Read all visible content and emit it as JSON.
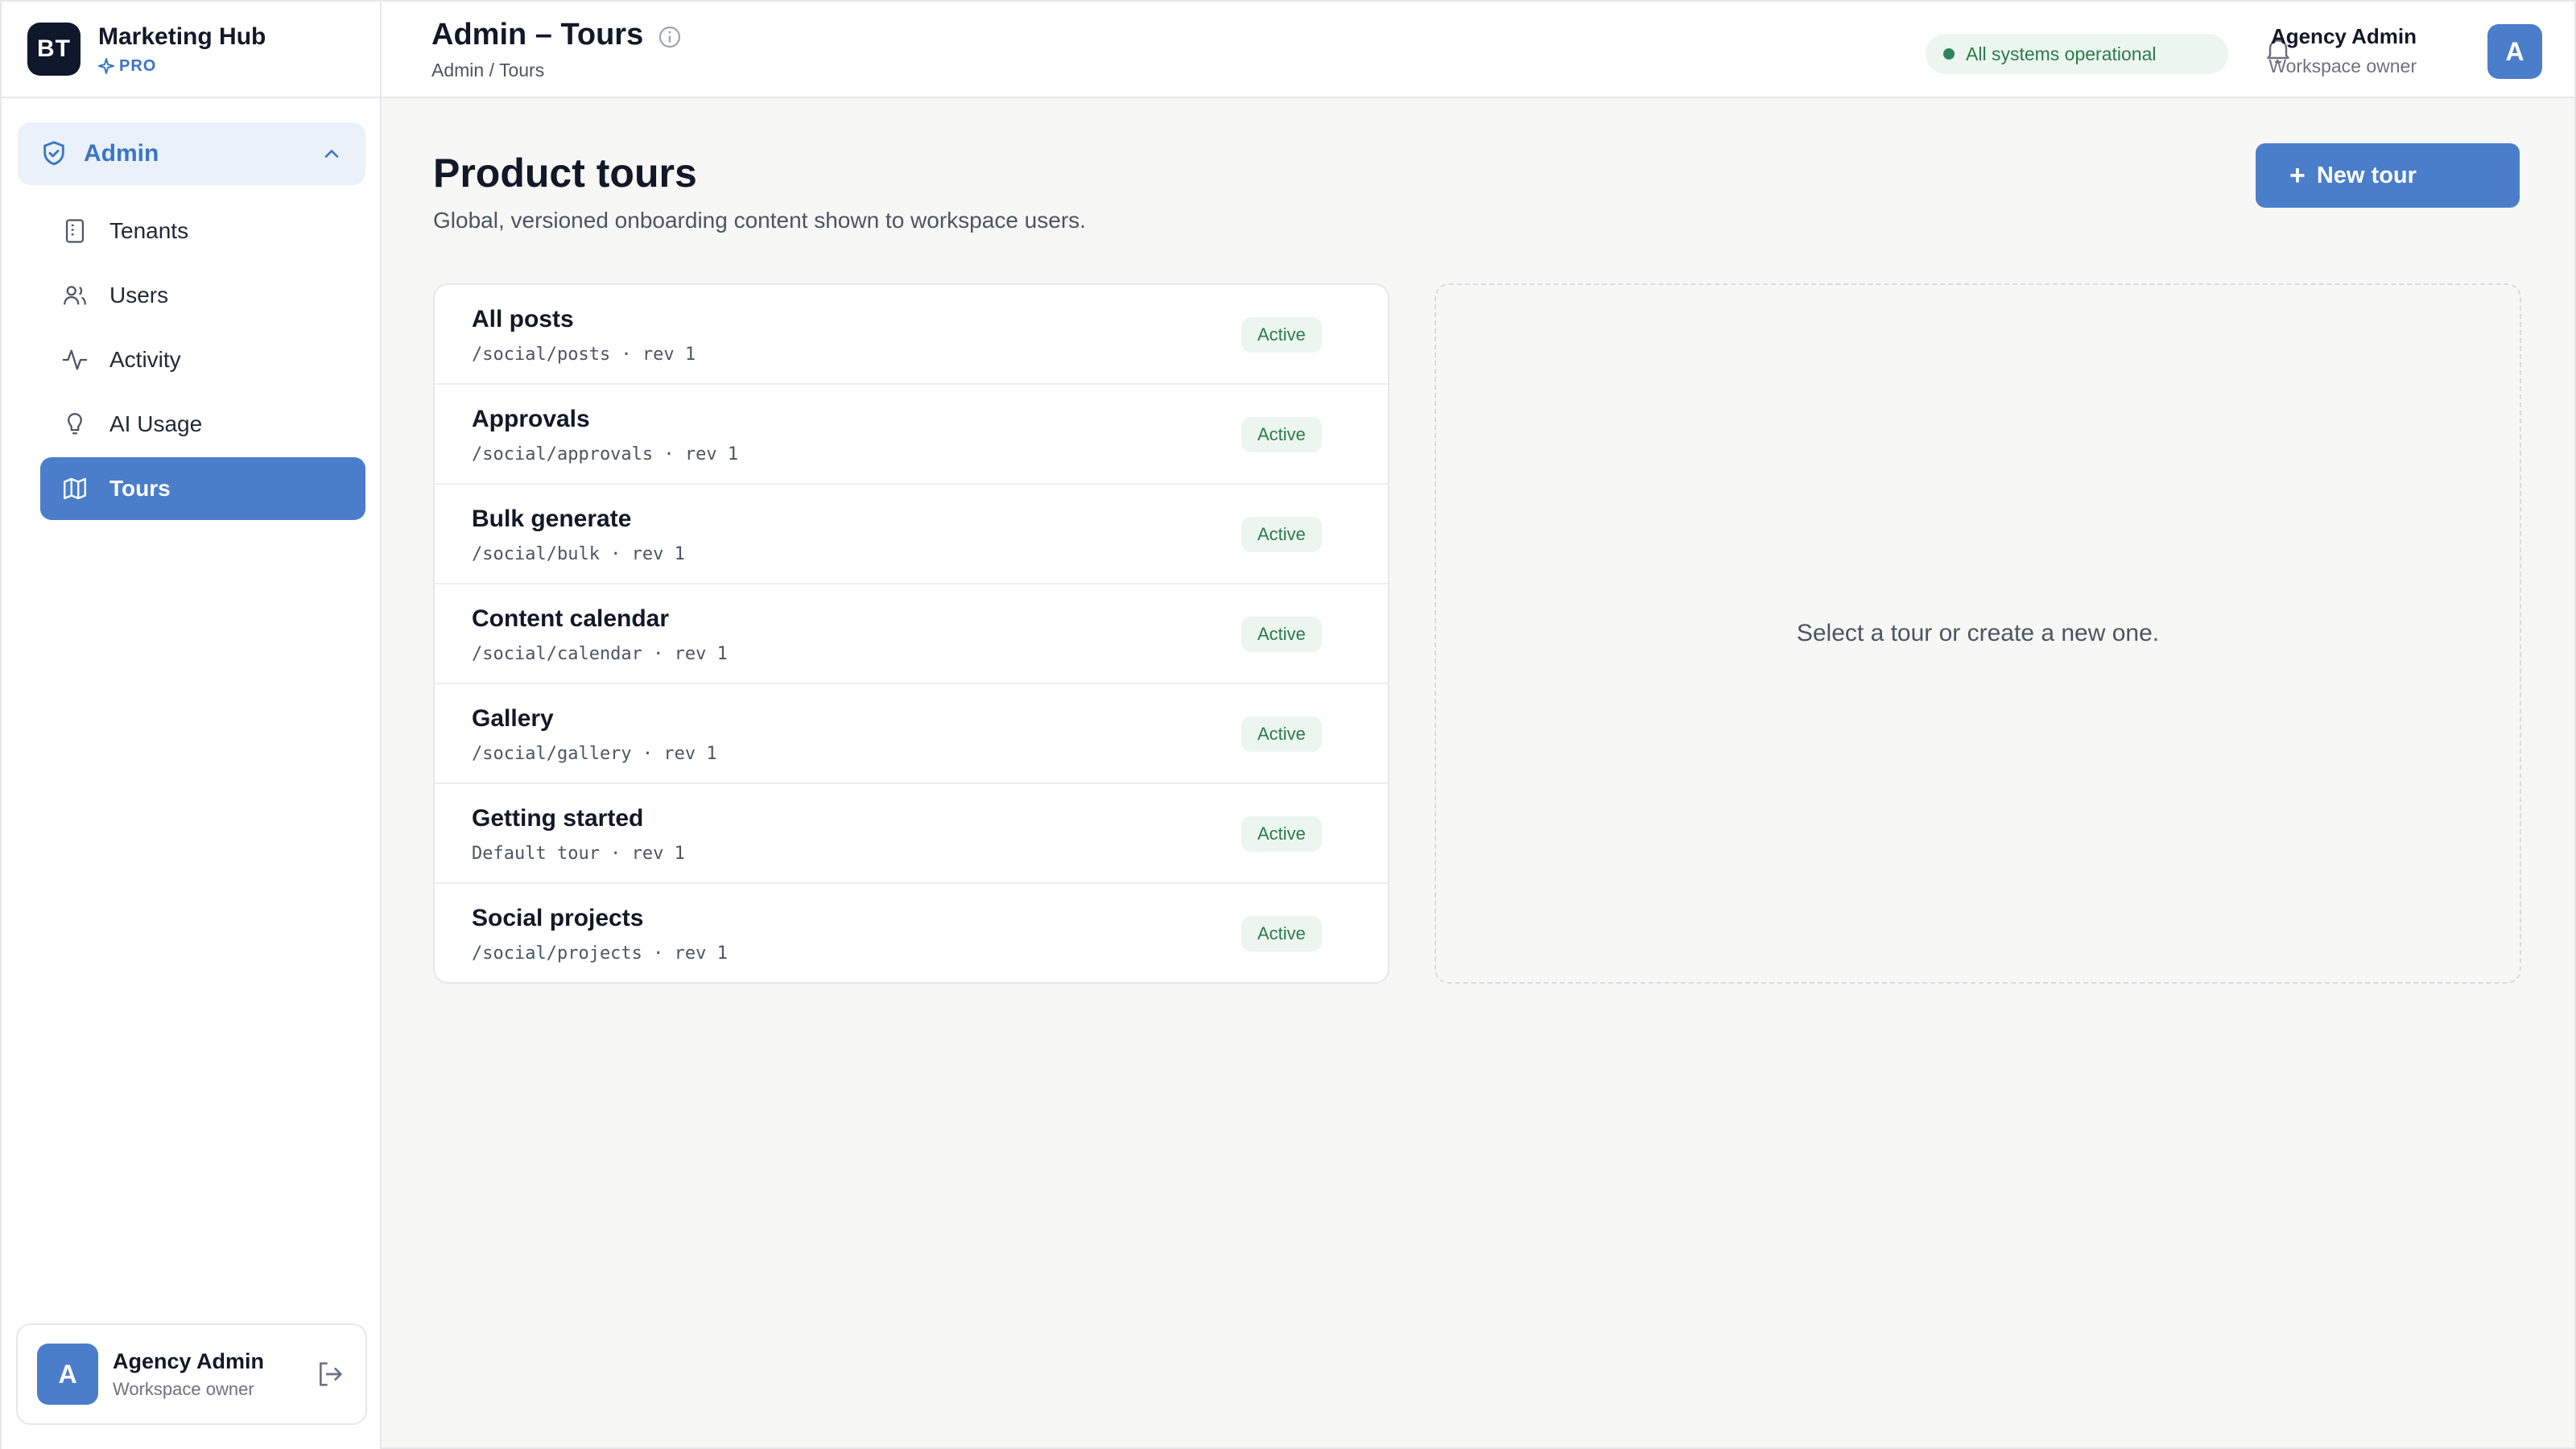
{
  "brand": {
    "logo_text": "BT",
    "name": "Marketing Hub",
    "badge": "PRO"
  },
  "sidebar": {
    "section_label": "Admin",
    "items": [
      {
        "label": "Tenants",
        "icon": "document-icon",
        "active": false
      },
      {
        "label": "Users",
        "icon": "users-icon",
        "active": false
      },
      {
        "label": "Activity",
        "icon": "activity-icon",
        "active": false
      },
      {
        "label": "AI Usage",
        "icon": "bulb-icon",
        "active": false
      },
      {
        "label": "Tours",
        "icon": "map-icon",
        "active": true
      }
    ],
    "profile": {
      "avatar_letter": "A",
      "name": "Agency Admin",
      "role": "Workspace owner"
    }
  },
  "header": {
    "title": "Admin – Tours",
    "breadcrumb": "Admin / Tours",
    "status": "All systems operational",
    "user_name": "Agency Admin",
    "user_role": "Workspace owner",
    "avatar_letter": "A"
  },
  "main": {
    "title": "Product tours",
    "subtitle": "Global, versioned onboarding content shown to workspace users.",
    "new_button": "New tour",
    "tours": [
      {
        "name": "All posts",
        "meta": "/social/posts · rev 1",
        "status": "Active"
      },
      {
        "name": "Approvals",
        "meta": "/social/approvals · rev 1",
        "status": "Active"
      },
      {
        "name": "Bulk generate",
        "meta": "/social/bulk · rev 1",
        "status": "Active"
      },
      {
        "name": "Content calendar",
        "meta": "/social/calendar · rev 1",
        "status": "Active"
      },
      {
        "name": "Gallery",
        "meta": "/social/gallery · rev 1",
        "status": "Active"
      },
      {
        "name": "Getting started",
        "meta": "Default tour · rev 1",
        "status": "Active"
      },
      {
        "name": "Social projects",
        "meta": "/social/projects · rev 1",
        "status": "Active"
      }
    ],
    "empty_state": "Select a tour or create a new one."
  },
  "colors": {
    "accent": "#4a7ecb",
    "success": "#2b7a4b",
    "success_bg": "#ecf6ef",
    "dark": "#0f172a"
  }
}
